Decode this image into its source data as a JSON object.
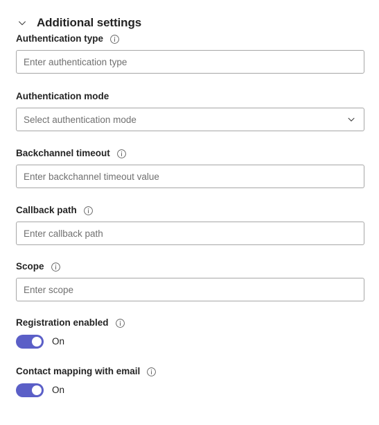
{
  "section": {
    "title": "Additional settings",
    "expanded": true,
    "chevron_icon": "chevron-down-icon"
  },
  "theme": {
    "accent": "#5B5FC7",
    "text": "#242424",
    "placeholder": "#707070",
    "border": "#A6A6A6",
    "background": "#FFFFFF"
  },
  "fields": [
    {
      "key": "authentication_type",
      "label": "Authentication type",
      "has_info": true,
      "info_icon": "info-icon",
      "control": "text",
      "placeholder": "Enter authentication type",
      "value": ""
    },
    {
      "key": "authentication_mode",
      "label": "Authentication mode",
      "has_info": false,
      "control": "dropdown",
      "placeholder": "Select authentication mode",
      "value": "Select authentication mode",
      "chevron_icon": "chevron-down-icon"
    },
    {
      "key": "backchannel_timeout",
      "label": "Backchannel timeout",
      "has_info": true,
      "info_icon": "info-icon",
      "control": "text",
      "placeholder": "Enter backchannel timeout value",
      "value": ""
    },
    {
      "key": "callback_path",
      "label": "Callback path",
      "has_info": true,
      "info_icon": "info-icon",
      "control": "text",
      "placeholder": "Enter callback path",
      "value": ""
    },
    {
      "key": "scope",
      "label": "Scope",
      "has_info": true,
      "info_icon": "info-icon",
      "control": "text",
      "placeholder": "Enter scope",
      "value": ""
    }
  ],
  "toggles": [
    {
      "key": "registration_enabled",
      "label": "Registration enabled",
      "has_info": true,
      "info_icon": "info-icon",
      "state_label": "On",
      "checked": true
    },
    {
      "key": "contact_mapping_with_email",
      "label": "Contact mapping with email",
      "has_info": true,
      "info_icon": "info-icon",
      "state_label": "On",
      "checked": true
    }
  ]
}
